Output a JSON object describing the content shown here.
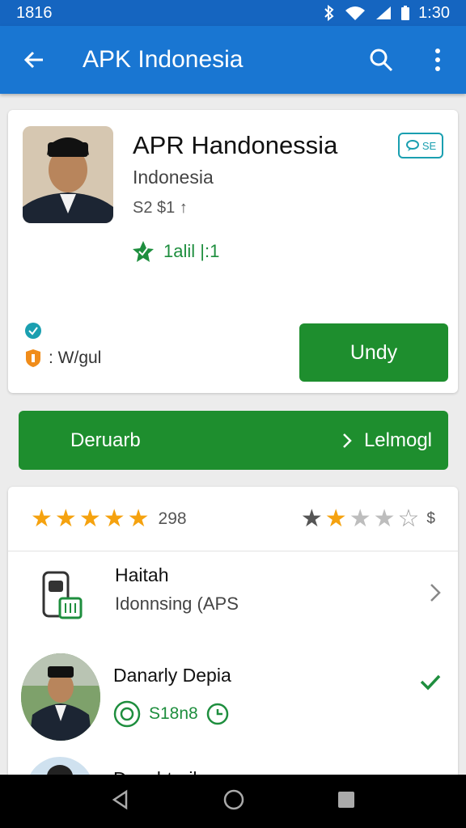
{
  "status": {
    "time": "1816",
    "clock": "1:30"
  },
  "app_bar": {
    "title": "APK Indonesia",
    "icons": [
      "back-arrow-icon",
      "search-icon",
      "more-vert-icon"
    ]
  },
  "app": {
    "name": "APR Handonessia",
    "publisher": "Indonesia",
    "meta": "S2 $1 ↑",
    "rating_text": "1alil |:1",
    "badge_text": "SE",
    "size_text": ": W/gul",
    "install_label": "Undy"
  },
  "download": {
    "label": "Deruarb",
    "right_label": "Lelmogl"
  },
  "rating": {
    "count": "298",
    "left_stars_filled": 5,
    "right_stars": "2 of 5",
    "right_symbol": "$"
  },
  "rows": [
    {
      "title": "Haitah",
      "subtitle": "Idonnsing (APS"
    },
    {
      "title": "Danarly Depia",
      "meta": "S18n8"
    },
    {
      "title": "Danshtaril"
    }
  ],
  "colors": {
    "primary": "#1976d2",
    "status": "#1565c0",
    "green": "#1e8e2e",
    "star": "#f5a20f"
  }
}
